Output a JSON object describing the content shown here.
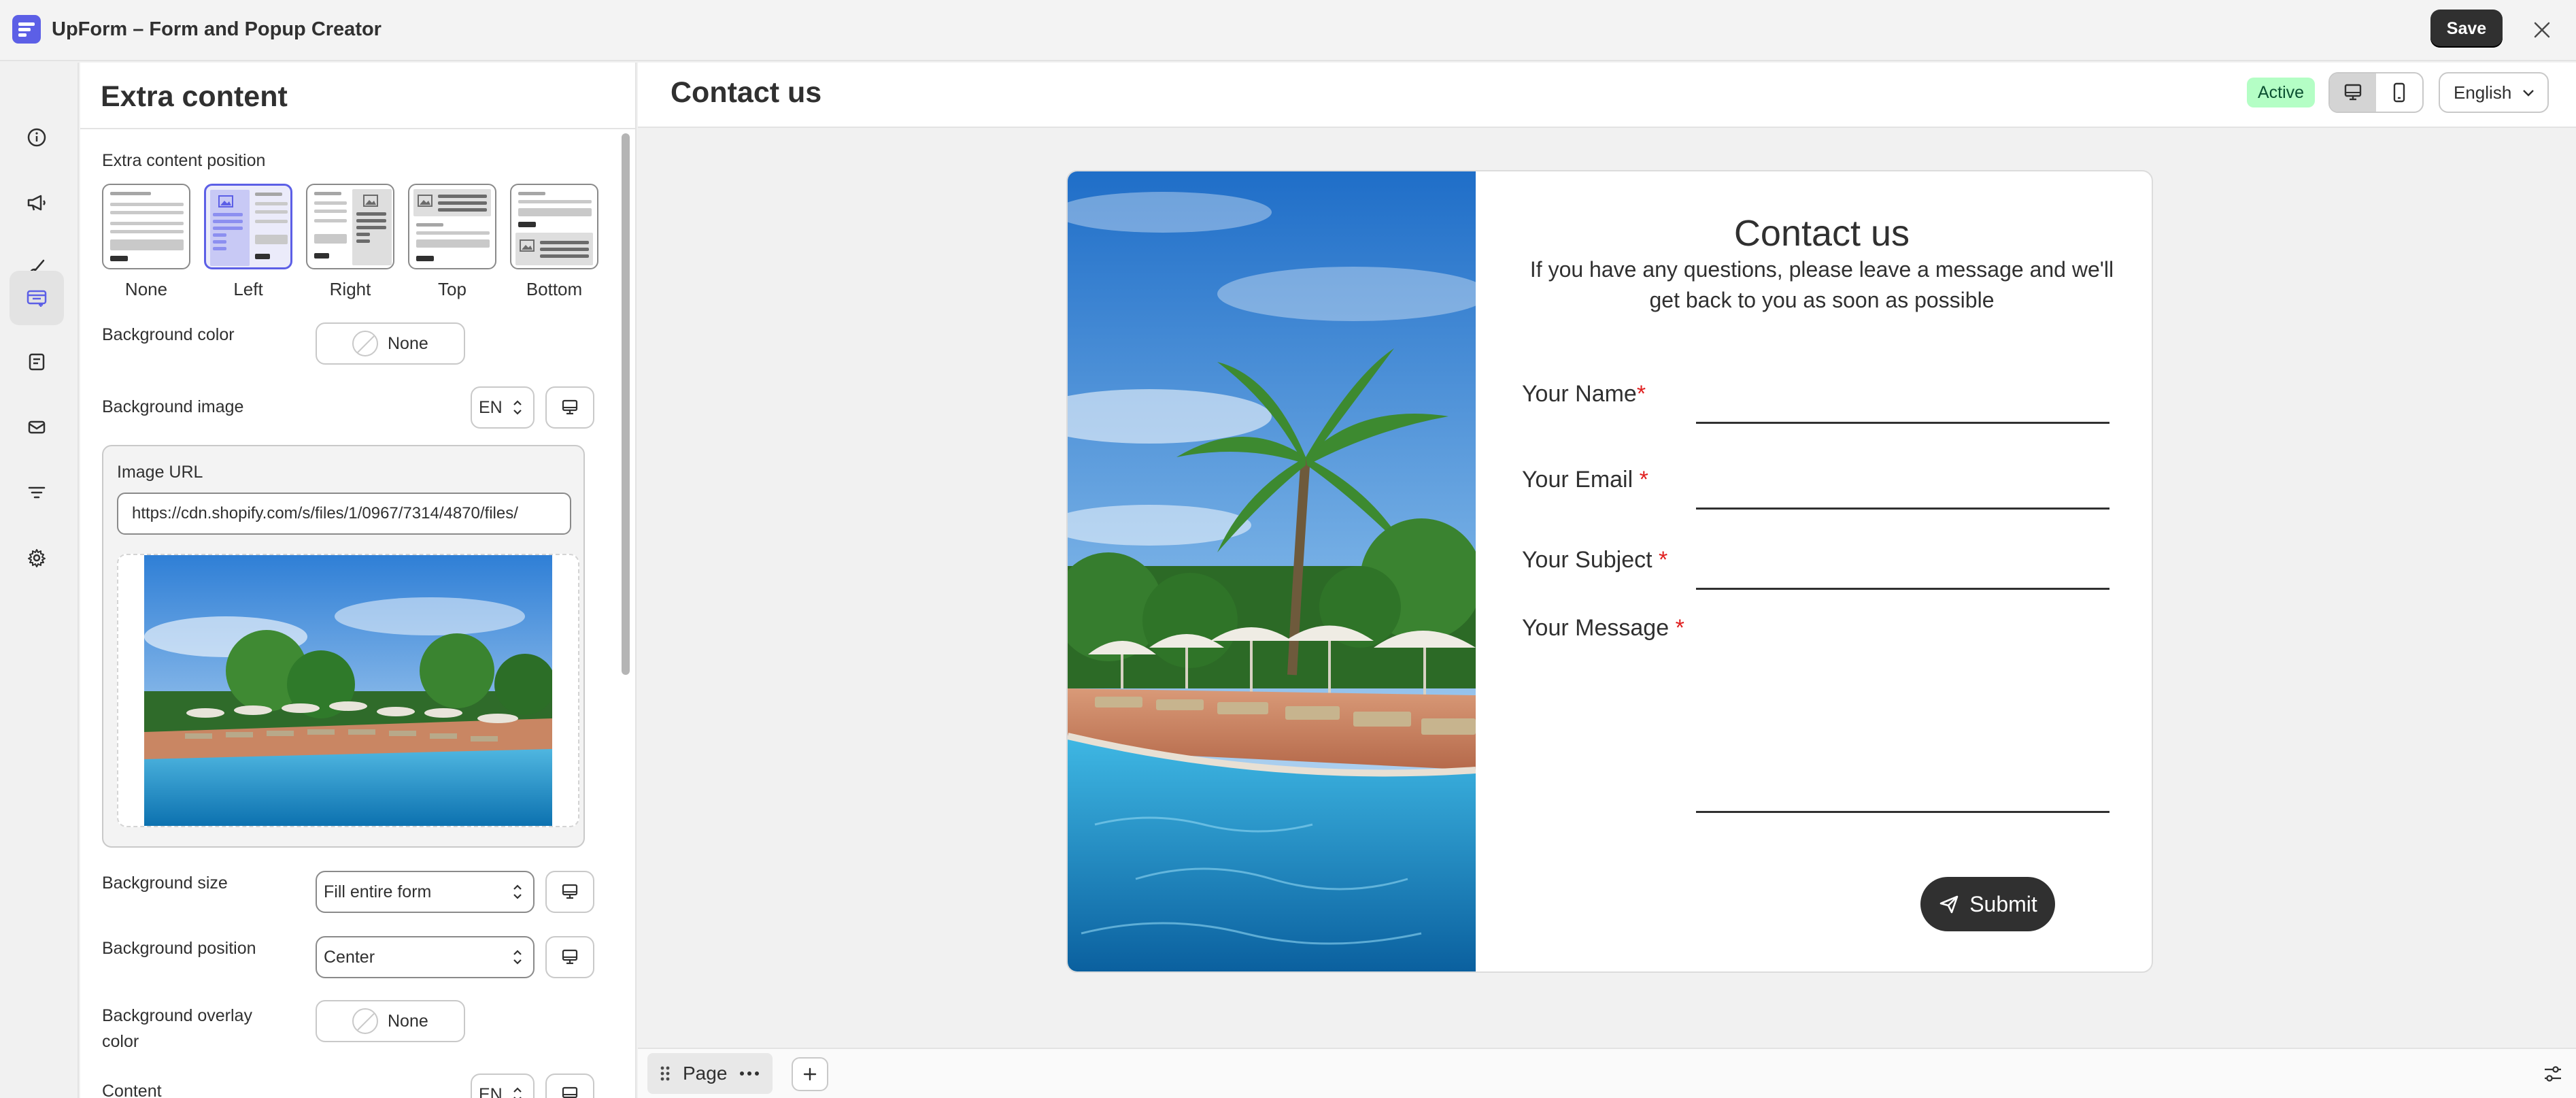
{
  "app": {
    "title": "UpForm – Form and Popup Creator",
    "save_label": "Save"
  },
  "rail": {
    "items": [
      "info-icon",
      "megaphone-icon",
      "brush-icon",
      "extra-content-icon",
      "form-fields-icon",
      "mail-icon",
      "filter-icon",
      "gear-icon"
    ],
    "active": "extra-content-icon"
  },
  "panel": {
    "title": "Extra content",
    "position_label": "Extra content position",
    "positions": [
      "None",
      "Left",
      "Right",
      "Top",
      "Bottom"
    ],
    "selected_position": "Left",
    "bg_color_label": "Background color",
    "bg_color_value": "None",
    "bg_image_label": "Background image",
    "lang_short": "EN",
    "image_url_label": "Image URL",
    "image_url_value": "https://cdn.shopify.com/s/files/1/0967/7314/4870/files/",
    "bg_size_label": "Background size",
    "bg_size_value": "Fill entire form",
    "bg_position_label": "Background position",
    "bg_position_value": "Center",
    "overlay_label": "Background overlay color",
    "overlay_value": "None",
    "content_label": "Content",
    "content_lang": "EN"
  },
  "preview": {
    "title": "Contact us",
    "status": "Active",
    "language": "English",
    "accent": "#5c5fe6"
  },
  "form": {
    "title": "Contact us",
    "description": "If you have any questions, please leave a message and we'll get back to you as soon as possible",
    "fields": [
      {
        "label": "Your Name",
        "required_mark": "*"
      },
      {
        "label": "Your Email ",
        "required_mark": "*"
      },
      {
        "label": "Your Subject ",
        "required_mark": "*"
      },
      {
        "label": "Your Message ",
        "required_mark": "*"
      }
    ],
    "submit_label": "Submit"
  },
  "bottom": {
    "page_label": "Page"
  }
}
